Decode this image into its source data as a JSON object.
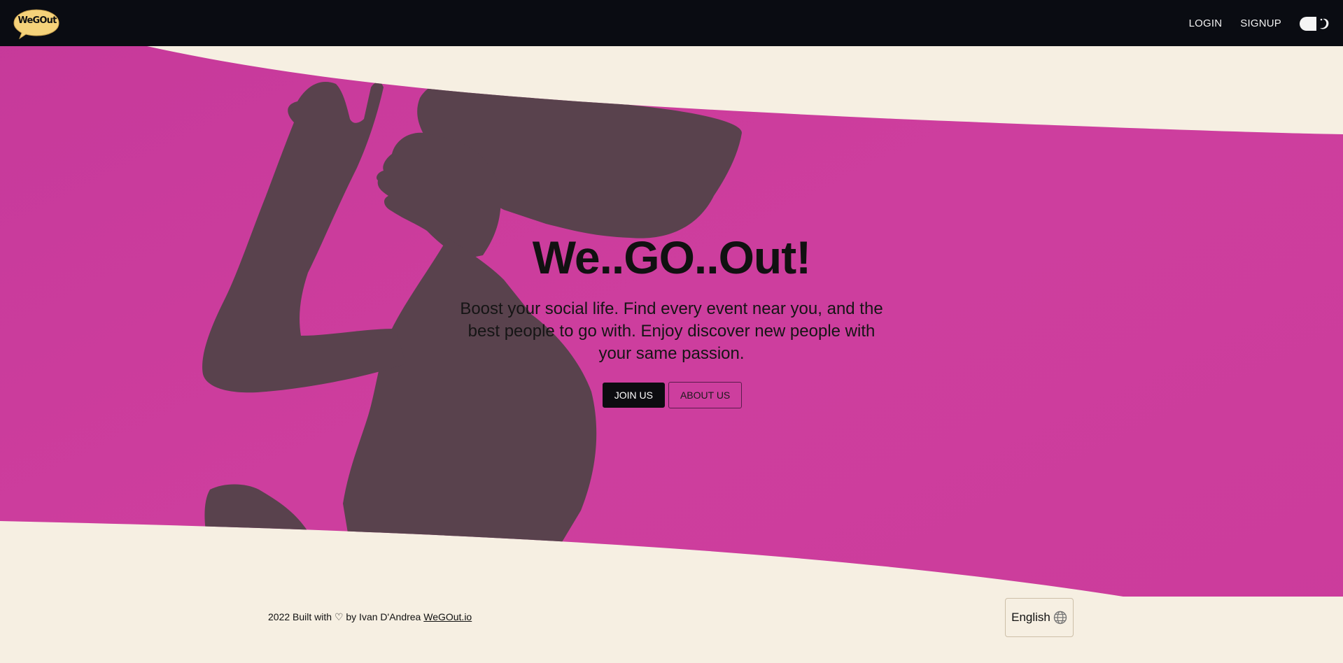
{
  "brand": {
    "logo_text": "WeGOut",
    "logo_color": "#f5d27a"
  },
  "nav": {
    "login_label": "LOGIN",
    "signup_label": "SIGNUP",
    "theme_icon": "moon-icon"
  },
  "hero": {
    "title": "We..GO..Out!",
    "description": "Boost your social life. Find every event near you, and the best people to go with. Enjoy discover new people with your same passion.",
    "join_label": "JOIN US",
    "about_label": "ABOUT US",
    "accent_color": "#cc3c9e"
  },
  "footer": {
    "credit_prefix": "2022 Built with ♡ by Ivan D'Andrea",
    "credit_link": "WeGOut.io",
    "language_label": "English",
    "language_icon": "globe-icon"
  },
  "colors": {
    "nav_bg": "#0a0c12",
    "page_bg": "#f6efe2",
    "hero_bg": "#cc3c9e"
  }
}
